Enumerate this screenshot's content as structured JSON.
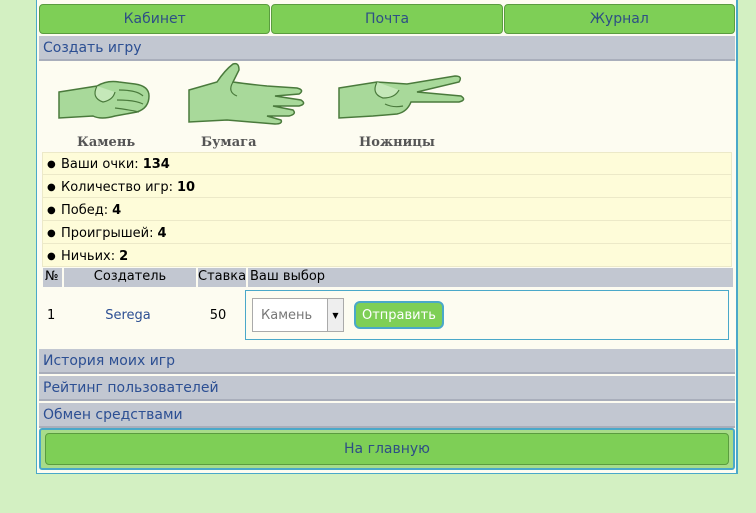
{
  "topnav": {
    "cabinet": "Кабинет",
    "mail": "Почта",
    "journal": "Журнал"
  },
  "sections": {
    "create_game": "Создать игру",
    "history": "История моих игр",
    "rating": "Рейтинг пользователей",
    "exchange": "Обмен средствами"
  },
  "hands": [
    {
      "label": "Камень",
      "icon": "rock-hand-icon"
    },
    {
      "label": "Бумага",
      "icon": "paper-hand-icon"
    },
    {
      "label": "Ножницы",
      "icon": "scissors-hand-icon"
    }
  ],
  "stats": [
    {
      "label": "Ваши очки:",
      "value": "134"
    },
    {
      "label": "Количество игр:",
      "value": "10"
    },
    {
      "label": "Побед:",
      "value": "4"
    },
    {
      "label": "Проигрышей:",
      "value": "4"
    },
    {
      "label": "Ничьих:",
      "value": "2"
    }
  ],
  "table": {
    "headers": {
      "num": "№",
      "creator": "Создатель",
      "bet": "Ставка",
      "choice": "Ваш выбор"
    },
    "rows": [
      {
        "num": "1",
        "creator": "Serega",
        "bet": "50",
        "selected": "Камень"
      }
    ],
    "send_label": "Отправить"
  },
  "home_label": "На главную",
  "colors": {
    "background": "#d3f0c2",
    "button_green": "#7ecf56",
    "header_gray": "#c2c7d1",
    "link_blue": "#2c4f93",
    "border_blue": "#4aa8c9"
  }
}
